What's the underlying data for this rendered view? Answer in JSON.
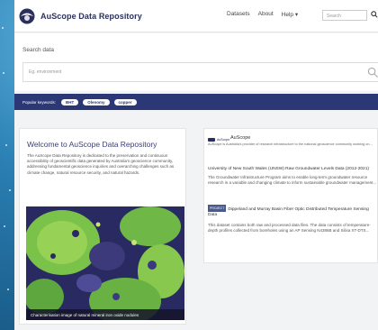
{
  "header": {
    "brand": "AuScope Data Repository",
    "nav": [
      "Datasets",
      "About",
      "Help ▾"
    ],
    "search_placeholder": "Search"
  },
  "search": {
    "title": "Search data",
    "placeholder": "Eg. environment"
  },
  "keywords": {
    "label": "Popular keywords:",
    "items": [
      "BHT",
      "Olenomy",
      "copper"
    ]
  },
  "welcome": {
    "title": "Welcome to AuScope Data Repository",
    "body": "The AuScope Data Repository is dedicated to the preservation and continuous accessibility of geoscientific data generated by Australia's geoscience community, addressing fundamental geoscience inquiries and overarching challenges such as climate change, natural resource security, and natural hazards.",
    "image_caption": "Characterisation image of natural mineral iron oxide nodules"
  },
  "right": {
    "org_logo_text": "AuScope",
    "org_name": "AuScope",
    "org_desc": "AuScope is Australia's provider of research infrastructure to the national geoscience community working on...",
    "item1_title": "University of New South Wales (UNSW) Raw Groundwater Levels Data (2012-2021)",
    "item1_body": "The Groundwater Infrastructure Program aims to enable long-term groundwater resource research in a variable and changing climate to inform sustainable groundwater management...",
    "item2_tag": "PROJECT",
    "item2_title": "Dippeland and Murray Basin Fiber Optic Distributed Temperature Sensing Data",
    "item2_body": "This dataset contains both raw and processed data files. The data consists of temperature-depth profiles collected from boreholes using an AP Sensing N4386B and Silixa XT-DTS..."
  }
}
